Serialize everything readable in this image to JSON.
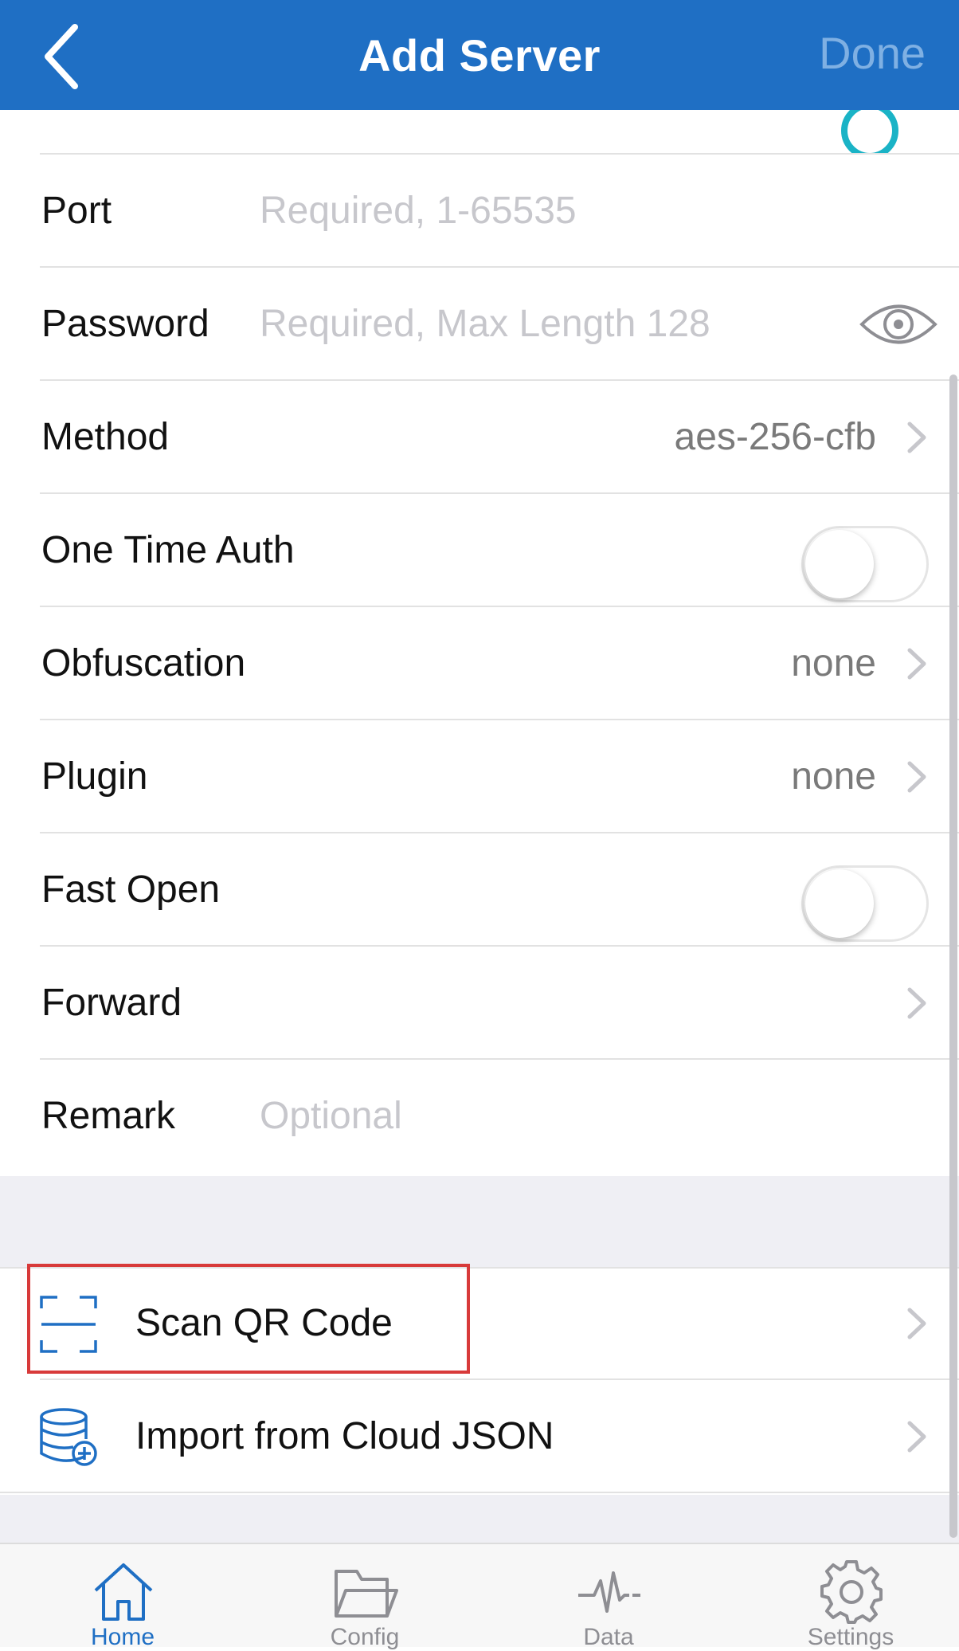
{
  "navbar": {
    "title": "Add Server",
    "done_label": "Done",
    "back_icon": "chevron-left-icon"
  },
  "form": {
    "port": {
      "label": "Port",
      "placeholder": "Required, 1-65535"
    },
    "password": {
      "label": "Password",
      "placeholder": "Required, Max Length 128",
      "icon": "eye-icon"
    },
    "method": {
      "label": "Method",
      "value": "aes-256-cfb"
    },
    "one_time_auth": {
      "label": "One Time Auth",
      "on": false
    },
    "obfuscation": {
      "label": "Obfuscation",
      "value": "none"
    },
    "plugin": {
      "label": "Plugin",
      "value": "none"
    },
    "fast_open": {
      "label": "Fast Open",
      "on": false
    },
    "forward": {
      "label": "Forward"
    },
    "remark": {
      "label": "Remark",
      "placeholder": "Optional"
    }
  },
  "actions": {
    "scan_qr": {
      "label": "Scan QR Code",
      "icon": "qr-scan-icon"
    },
    "import_cloud": {
      "label": "Import from Cloud JSON",
      "icon": "database-add-icon"
    }
  },
  "tabbar": {
    "items": [
      {
        "label": "Home",
        "icon": "home-icon",
        "active": true
      },
      {
        "label": "Config",
        "icon": "folder-icon",
        "active": false
      },
      {
        "label": "Data",
        "icon": "pulse-icon",
        "active": false
      },
      {
        "label": "Settings",
        "icon": "gear-icon",
        "active": false
      }
    ]
  },
  "colors": {
    "navbar": "#1f6fc4",
    "highlight": "#d83a3a",
    "placeholder": "#c7c7cc"
  }
}
